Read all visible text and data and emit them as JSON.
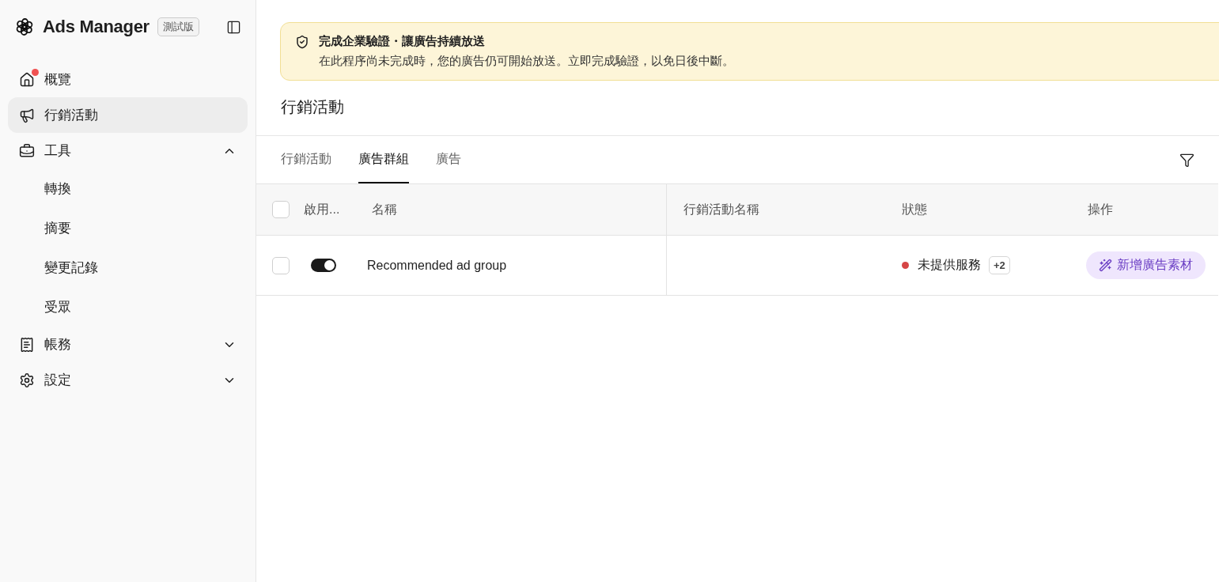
{
  "sidebar": {
    "brand": "Ads Manager",
    "badge": "測試版",
    "items": [
      {
        "label": "概覽",
        "kind": "home",
        "selected": false,
        "notification": true
      },
      {
        "label": "行銷活動",
        "kind": "megaphone",
        "selected": true,
        "notification": false
      },
      {
        "label": "工具",
        "kind": "toolbox",
        "selected": false,
        "notification": false,
        "expanded": true,
        "children": [
          {
            "label": "轉換",
            "selected": false
          },
          {
            "label": "摘要",
            "selected": false
          },
          {
            "label": "變更記錄",
            "selected": false
          },
          {
            "label": "受眾",
            "selected": false
          }
        ]
      },
      {
        "label": "帳務",
        "kind": "receipt",
        "selected": false,
        "notification": false,
        "expanded": false
      },
      {
        "label": "設定",
        "kind": "gear",
        "selected": false,
        "notification": false,
        "expanded": false
      }
    ]
  },
  "banner": {
    "title": "完成企業驗證・讓廣告持續放送",
    "message": "在此程序尚未完成時，您的廣告仍可開始放送。立即完成驗證，以免日後中斷。"
  },
  "page_title": "行銷活動",
  "tabs": [
    {
      "label": "行銷活動",
      "selected": false
    },
    {
      "label": "廣告群組",
      "selected": true
    },
    {
      "label": "廣告",
      "selected": false
    }
  ],
  "table": {
    "all_checked": false,
    "columns": [
      "啟用...",
      "名稱",
      "行銷活動名稱",
      "狀態",
      "操作"
    ],
    "rows": [
      {
        "checked": false,
        "enabled": true,
        "name": "Recommended ad group",
        "status": "未提供服務",
        "color": "#d64545",
        "extra": "+2",
        "action": "新增廣告素材"
      }
    ]
  }
}
